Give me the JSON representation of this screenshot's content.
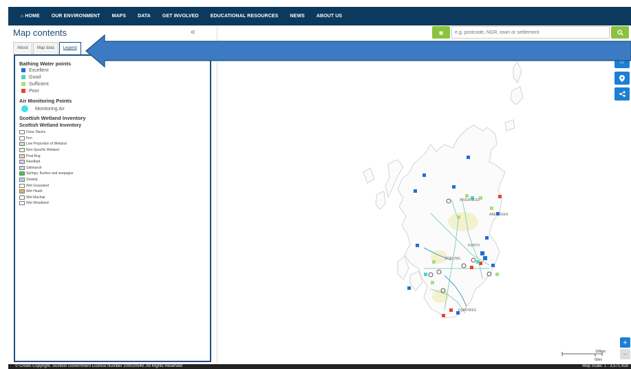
{
  "nav": {
    "items": [
      {
        "label": "HOME",
        "icon": "home-icon"
      },
      {
        "label": "OUR ENVIRONMENT"
      },
      {
        "label": "MAPS"
      },
      {
        "label": "DATA"
      },
      {
        "label": "GET INVOLVED"
      },
      {
        "label": "EDUCATIONAL RESOURCES"
      },
      {
        "label": "NEWS"
      },
      {
        "label": "ABOUT US"
      }
    ]
  },
  "sidebar": {
    "title": "Map contents",
    "collapse_icon": "double-chevron-left-icon",
    "tabs": [
      "About",
      "Map data",
      "Legend"
    ],
    "active_tab": "Legend",
    "legend": {
      "bathing_heading": "Bathing Water points",
      "bathing_items": [
        {
          "label": "Excellent",
          "color": "#1f6fd6"
        },
        {
          "label": "Good",
          "color": "#52d3c8"
        },
        {
          "label": "Sufficient",
          "color": "#a7e07a"
        },
        {
          "label": "Poor",
          "color": "#e8432b"
        }
      ],
      "air_heading": "Air Monitoring Points",
      "air_item": "Monitoring Air",
      "wetland_heading_1": "Scottish Wetland Inventory",
      "wetland_heading_2": "Scottish Wetland Inventory",
      "wetland_items": [
        {
          "label": "Dune Slacks",
          "color": "#ffffff"
        },
        {
          "label": "Fen",
          "color": "#ffffff"
        },
        {
          "label": "Low Proportion of Wetland",
          "color": "#c9e6b0"
        },
        {
          "label": "Non-Specific Wetland",
          "color": "#e9f3dc"
        },
        {
          "label": "Peat Bog",
          "color": "#f3c7c7"
        },
        {
          "label": "Reedbed",
          "color": "#cfd3e8"
        },
        {
          "label": "Saltmarsh",
          "color": "#c8d6ee"
        },
        {
          "label": "Springs, flushes and seepages",
          "color": "#37d137"
        },
        {
          "label": "Swamp",
          "color": "#b8d2ee"
        },
        {
          "label": "Wet Grassland",
          "color": "#ffffff"
        },
        {
          "label": "Wet Heath",
          "color": "#f1b244"
        },
        {
          "label": "Wet Machair",
          "color": "#ffffff"
        },
        {
          "label": "Wet Woodland",
          "color": "#ffffff"
        }
      ]
    }
  },
  "search": {
    "placeholder": "e.g. postcode, NGR, town or settlement",
    "eye_icon": "eye-icon",
    "search_icon": "search-icon"
  },
  "map_controls": {
    "home_icon": "home-icon",
    "location_icon": "map-marker-icon",
    "share_icon": "share-icon",
    "zoom_in": "+",
    "zoom_out": "−"
  },
  "map_labels": {
    "aberdeen": "ABERDEEN",
    "inverness": "INVERNESS",
    "perth": "PERTH",
    "stirling": "STIRLING",
    "dumfries": "DUMFRIES"
  },
  "scale": {
    "km": "100km",
    "mi": "60mi"
  },
  "footer": {
    "copyright": "© Crown Copyright. Scottish Government Licence Number 100020540. All Rights Reserved",
    "map_scale": "Map Scale: 1 : 3,571,428"
  },
  "colors": {
    "nav_bg": "#0b3a5e",
    "accent_green": "#8ac33f",
    "control_blue": "#1d7fd4",
    "arrow_blue": "#3c7bc4"
  }
}
